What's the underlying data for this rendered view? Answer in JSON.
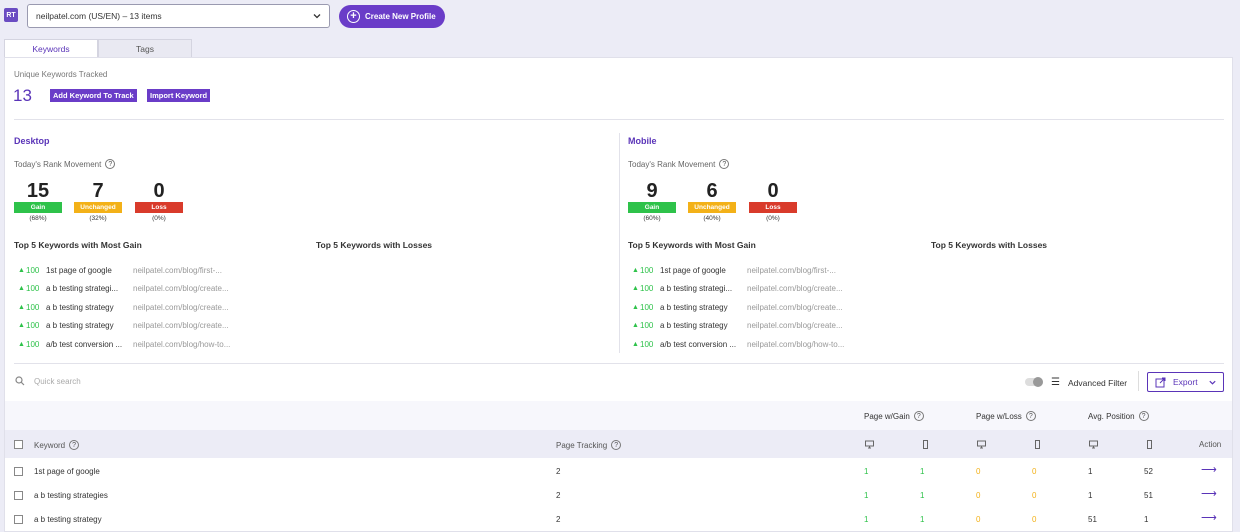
{
  "header": {
    "logo": "RT",
    "profile_value": "neilpatel.com (US/EN) – 13 items",
    "create_label": "Create New Profile"
  },
  "tabs": [
    {
      "label": "Keywords",
      "active": true
    },
    {
      "label": "Tags",
      "active": false
    }
  ],
  "summary": {
    "label": "Unique Keywords Tracked",
    "count": "13",
    "add_label": "Add Keyword To Track",
    "import_label": "Import Keyword"
  },
  "desktop": {
    "title": "Desktop",
    "movement_label": "Today's Rank Movement",
    "gain": {
      "num": "15",
      "label": "Gain",
      "pct": "(68%)"
    },
    "unchanged": {
      "num": "7",
      "label": "Unchanged",
      "pct": "(32%)"
    },
    "loss": {
      "num": "0",
      "label": "Loss",
      "pct": "(0%)"
    },
    "gain_title": "Top 5 Keywords with Most Gain",
    "loss_title": "Top 5 Keywords with Losses",
    "gain_list": [
      {
        "val": "100",
        "name": "1st page of google",
        "url": "neilpatel.com/blog/first-..."
      },
      {
        "val": "100",
        "name": "a b testing strategi...",
        "url": "neilpatel.com/blog/create..."
      },
      {
        "val": "100",
        "name": "a b testing strategy",
        "url": "neilpatel.com/blog/create..."
      },
      {
        "val": "100",
        "name": "a b testing strategy",
        "url": "neilpatel.com/blog/create..."
      },
      {
        "val": "100",
        "name": "a/b test conversion ...",
        "url": "neilpatel.com/blog/how-to..."
      }
    ]
  },
  "mobile": {
    "title": "Mobile",
    "movement_label": "Today's Rank Movement",
    "gain": {
      "num": "9",
      "label": "Gain",
      "pct": "(60%)"
    },
    "unchanged": {
      "num": "6",
      "label": "Unchanged",
      "pct": "(40%)"
    },
    "loss": {
      "num": "0",
      "label": "Loss",
      "pct": "(0%)"
    },
    "gain_title": "Top 5 Keywords with Most Gain",
    "loss_title": "Top 5 Keywords with Losses",
    "gain_list": [
      {
        "val": "100",
        "name": "1st page of google",
        "url": "neilpatel.com/blog/first-..."
      },
      {
        "val": "100",
        "name": "a b testing strategi...",
        "url": "neilpatel.com/blog/create..."
      },
      {
        "val": "100",
        "name": "a b testing strategy",
        "url": "neilpatel.com/blog/create..."
      },
      {
        "val": "100",
        "name": "a b testing strategy",
        "url": "neilpatel.com/blog/create..."
      },
      {
        "val": "100",
        "name": "a/b test conversion ...",
        "url": "neilpatel.com/blog/how-to..."
      }
    ]
  },
  "toolbar": {
    "search_placeholder": "Quick search",
    "advanced_filter": "Advanced Filter",
    "export": "Export"
  },
  "table": {
    "group_headers": {
      "gain": "Page w/Gain",
      "loss": "Page w/Loss",
      "avg": "Avg. Position"
    },
    "col_keyword": "Keyword",
    "col_tracking": "Page Tracking",
    "col_action": "Action",
    "rows": [
      {
        "keyword": "1st page of google",
        "tracking": "2",
        "gain_d": "1",
        "gain_m": "1",
        "loss_d": "0",
        "loss_m": "0",
        "avg_d": "1",
        "avg_m": "52"
      },
      {
        "keyword": "a b testing strategies",
        "tracking": "2",
        "gain_d": "1",
        "gain_m": "1",
        "loss_d": "0",
        "loss_m": "0",
        "avg_d": "1",
        "avg_m": "51"
      },
      {
        "keyword": "a b testing strategy",
        "tracking": "2",
        "gain_d": "1",
        "gain_m": "1",
        "loss_d": "0",
        "loss_m": "0",
        "avg_d": "51",
        "avg_m": "1"
      }
    ]
  },
  "colors": {
    "accent": "#6a3cc8",
    "gain": "#2ec24a",
    "unchanged": "#f3b118",
    "loss": "#d93b2b"
  }
}
